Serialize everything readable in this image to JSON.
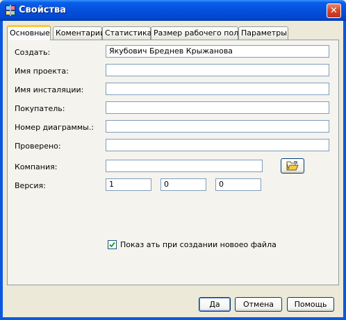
{
  "window": {
    "title": "Свойства",
    "app_icon": "app-icon",
    "close_label": "✕"
  },
  "tabs": [
    {
      "label": "Основные"
    },
    {
      "label": "Коментарии"
    },
    {
      "label": "Статистика"
    },
    {
      "label": "Размер рабочего поля"
    },
    {
      "label": "Параметры"
    }
  ],
  "form": {
    "author": {
      "label": "Создать:",
      "value": "Якубович Бреднев Крыжанова"
    },
    "project_name": {
      "label": "Имя проекта:",
      "value": ""
    },
    "install_name": {
      "label": "Имя инсталяции:",
      "value": ""
    },
    "customer": {
      "label": "Покупатель:",
      "value": ""
    },
    "diagram_number": {
      "label": "Номер диаграммы.:",
      "value": ""
    },
    "checked": {
      "label": "Проверено:",
      "value": ""
    },
    "company": {
      "label": "Компания:",
      "value": "",
      "browse_icon": "open-folder-icon"
    },
    "version": {
      "label": "Версия:",
      "major": "1",
      "minor": "0",
      "build": "0"
    },
    "show_on_create": {
      "label": "Показ ать при создании новоео файла",
      "checked": true
    }
  },
  "buttons": {
    "ok": "Да",
    "cancel": "Отмена",
    "help": "Помощь"
  }
}
